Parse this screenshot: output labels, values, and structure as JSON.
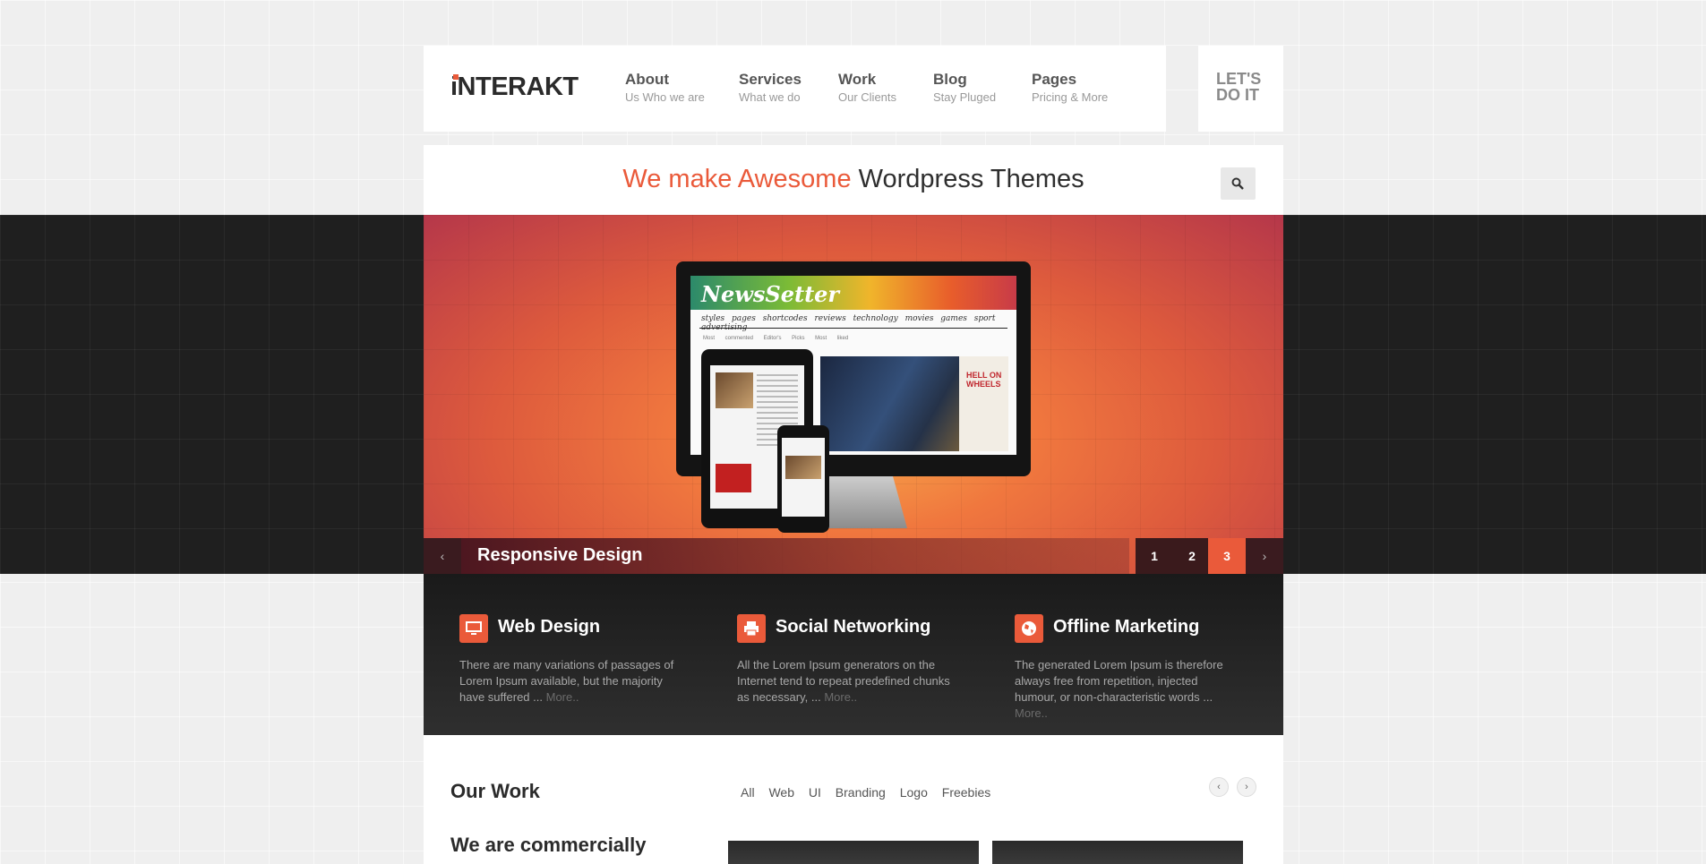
{
  "brand": {
    "logo": "iNTERAKT"
  },
  "nav": [
    {
      "title": "About",
      "sub": "Us Who we are"
    },
    {
      "title": "Services",
      "sub": "What we do"
    },
    {
      "title": "Work",
      "sub": "Our Clients"
    },
    {
      "title": "Blog",
      "sub": "Stay Pluged"
    },
    {
      "title": "Pages",
      "sub": "Pricing & More"
    }
  ],
  "cta": {
    "label": "LET'S DO IT"
  },
  "tagline": {
    "accent": "We make Awesome",
    "rest": "Wordpress Themes"
  },
  "hero": {
    "caption": "Responsive Design",
    "pages": [
      "1",
      "2",
      "3"
    ],
    "active_page": "3",
    "prev": "‹",
    "next": "›",
    "screen_logo": "NewsSetter",
    "screen_menu": "styles pages shortcodes reviews technology movies games sport advertising",
    "screen_sub": "Most commented Editor's Picks Most liked",
    "movie_tag": "HELL ON WHEELS"
  },
  "services": [
    {
      "icon": "monitor-icon",
      "title": "Web Design",
      "text": "There are many variations of passages of Lorem Ipsum available, but the majority have suffered ...",
      "more": "More.."
    },
    {
      "icon": "printer-icon",
      "title": "Social Networking",
      "text": "All the Lorem Ipsum generators on the Internet tend to repeat predefined chunks as necessary, ...",
      "more": "More.."
    },
    {
      "icon": "globe-icon",
      "title": "Offline Marketing",
      "text": "The generated Lorem Ipsum is therefore always free from repetition, injected humour, or non-characteristic words ...",
      "more": "More.."
    }
  ],
  "work": {
    "title": "Our Work",
    "filters": [
      "All",
      "Web",
      "UI",
      "Branding",
      "Logo",
      "Freebies"
    ],
    "prev": "‹",
    "next": "›",
    "tagline": "We are commercially"
  },
  "colors": {
    "accent": "#ea5a3a",
    "dark": "#1f1f1f"
  }
}
